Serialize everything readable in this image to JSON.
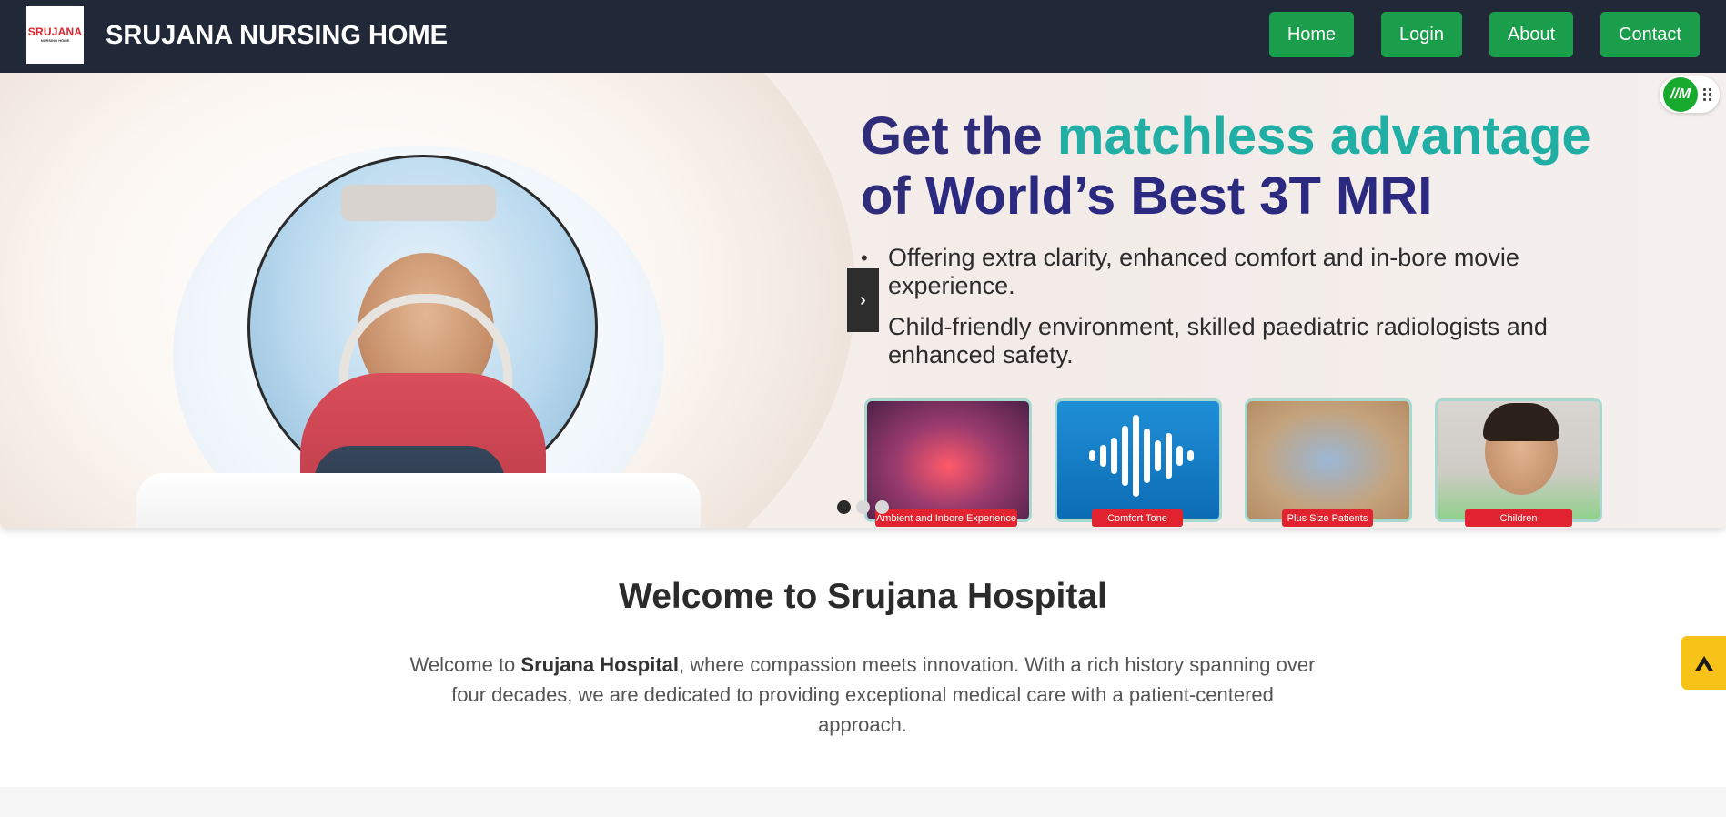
{
  "header": {
    "logo": {
      "main": "SRUJANA",
      "sub": "NURSING HOME"
    },
    "brand": "SRUJANA NURSING HOME",
    "nav": [
      {
        "label": "Home"
      },
      {
        "label": "Login"
      },
      {
        "label": "About"
      },
      {
        "label": "Contact"
      }
    ]
  },
  "hero": {
    "headline_line1_prefix": "Get the ",
    "headline_line1_accent": "matchless advantage",
    "headline_line2_prefix": "of ",
    "headline_line2_strong": "World’s Best 3T MRI",
    "bullets": [
      "Offering extra clarity, enhanced comfort and in-bore movie experience.",
      "Child-friendly environment, skilled paediatric radiologists and enhanced safety."
    ],
    "features": [
      {
        "label": "Ambient and Inbore Experience"
      },
      {
        "label": "Comfort Tone"
      },
      {
        "label": "Plus Size Patients"
      },
      {
        "label": "Children"
      }
    ],
    "next_icon": "›",
    "slides_total": 3,
    "active_slide": 1
  },
  "widget": {
    "label": "//M"
  },
  "welcome": {
    "title": "Welcome to Srujana Hospital",
    "text_before": "Welcome to ",
    "text_bold": "Srujana Hospital",
    "text_after": ", where compassion meets innovation. With a rich history spanning over four decades, we are dedicated to providing exceptional medical care with a patient-centered approach."
  },
  "colors": {
    "navbar_bg": "#212938",
    "nav_button": "#1a9e4b",
    "accent_teal": "#21aea4",
    "headline_navy": "#2b2a80",
    "feature_label_red": "#e0232e",
    "side_badge": "#f7c318"
  }
}
